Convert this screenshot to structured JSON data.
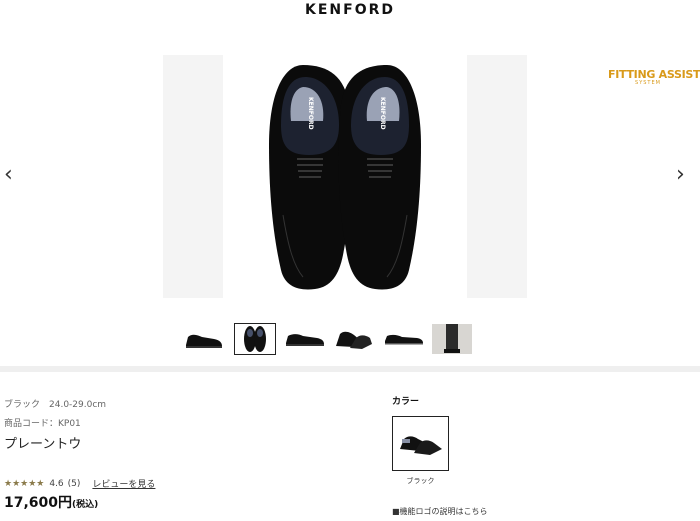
{
  "brand": {
    "name": "KENFORD"
  },
  "badge": {
    "title": "FITTING ASSIST",
    "subtitle": "SYSTEM"
  },
  "gallery": {
    "prev": "‹",
    "next": "›",
    "thumbnails": [
      "side view",
      "top view",
      "side view 2",
      "pair angle",
      "sole",
      "outfit"
    ],
    "active_index": 1,
    "shoe_logo": "KENFORD"
  },
  "product": {
    "spec": "ブラック　24.0-29.0cm",
    "code": "商品コード：KP01",
    "name": "プレーントウ",
    "rating": {
      "value": "4.6",
      "count": "(5)",
      "stars": "★★★★★",
      "reviews_link": "レビューを見る"
    },
    "price": "17,600円",
    "tax": "(税込)"
  },
  "color_section": {
    "label": "カラー",
    "selected": "ブラック",
    "logo_link": "■機能ロゴの説明はこちら"
  }
}
